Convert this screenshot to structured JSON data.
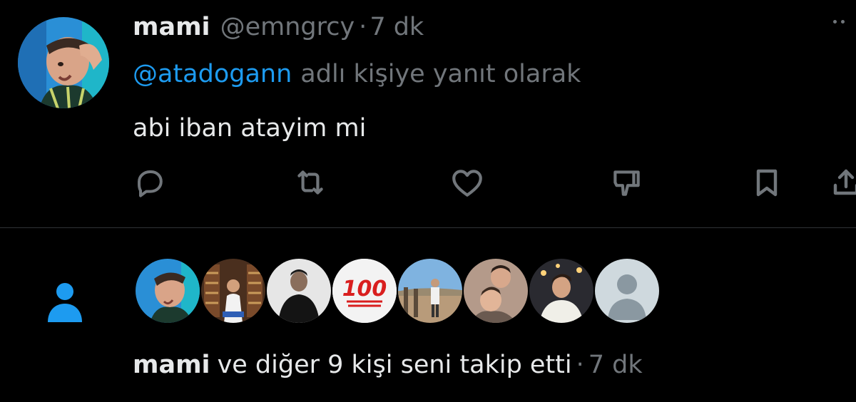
{
  "tweet": {
    "display_name": "mami",
    "handle": "@emngrcy",
    "separator": "·",
    "time": "7 dk",
    "reply_mention": "@atadogann",
    "reply_text": "adlı kişiye yanıt olarak",
    "body": "abi iban atayim mi",
    "actions": [
      "reply-icon",
      "retweet-icon",
      "like-icon",
      "downvote-icon",
      "bookmark-icon",
      "share-icon"
    ]
  },
  "notification": {
    "icon": "person-icon",
    "follower_avatars": [
      "avatar-1",
      "avatar-2",
      "avatar-3",
      "avatar-4-emoji-100",
      "avatar-5",
      "avatar-6",
      "avatar-7",
      "avatar-8-default"
    ],
    "emoji_avatar_text": "💯",
    "name": "mami",
    "rest": "ve diğer 9 kişi seni takip etti",
    "separator": "·",
    "time": "7 dk"
  },
  "colors": {
    "background": "#000000",
    "text_primary": "#e7e9ea",
    "text_secondary": "#71767b",
    "accent": "#1d9bf0",
    "divider": "#2f3336"
  }
}
